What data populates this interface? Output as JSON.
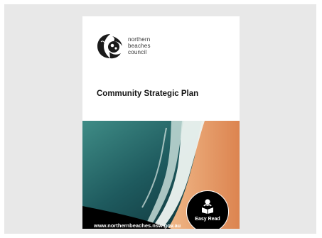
{
  "cover": {
    "logo": {
      "line1": "northern",
      "line2": "beaches",
      "line3": "council"
    },
    "title": "Community Strategic Plan",
    "url": "www.northernbeaches.nsw.gov.au",
    "badge": {
      "label": "Easy Read",
      "icon": "person-reading-icon"
    }
  },
  "colors": {
    "panel": "#e8e8e8",
    "ocean_deep": "#0f3b43",
    "ocean_teal": "#2a7a7a",
    "surf": "#eef4f1",
    "sand": "#e89a62",
    "badge": "#000000"
  }
}
